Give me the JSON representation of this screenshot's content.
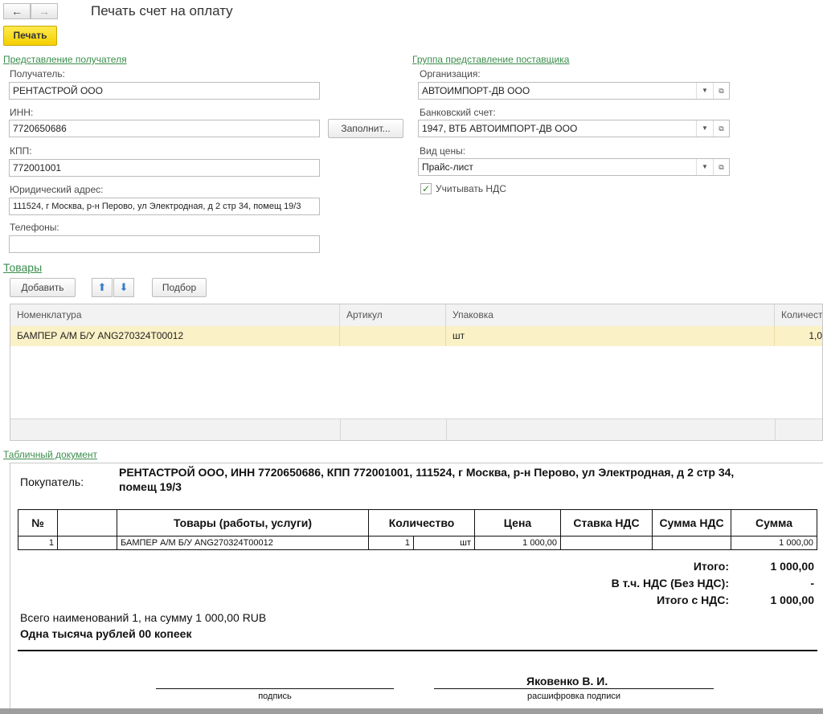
{
  "window": {
    "title": "Печать счет на оплату",
    "print_label": "Печать",
    "back_glyph": "←",
    "forward_glyph": "→"
  },
  "recipient": {
    "group_title": "Представление получателя",
    "recipient_label": "Получатель:",
    "recipient_value": "РЕНТАСТРОЙ ООО",
    "inn_label": "ИНН:",
    "inn_value": "7720650686",
    "fill_button": "Заполнит...",
    "kpp_label": "КПП:",
    "kpp_value": "772001001",
    "address_label": "Юридический адрес:",
    "address_value": "111524, г Москва, р-н Перово, ул Электродная, д 2 стр 34, помещ 19/3",
    "phones_label": "Телефоны:",
    "phones_value": ""
  },
  "supplier": {
    "group_title": "Группа представление поставщика",
    "org_label": "Организация:",
    "org_value": "АВТОИМПОРТ-ДВ ООО",
    "bank_label": "Банковский счет:",
    "bank_value": "1947, ВТБ АВТОИМПОРТ-ДВ ООО",
    "price_label": "Вид цены:",
    "price_value": "Прайс-лист",
    "vat_checkbox_label": "Учитывать НДС",
    "vat_checked": true
  },
  "goods": {
    "title": "Товары",
    "add_button": "Добавить",
    "up_glyph": "⬆",
    "down_glyph": "⬇",
    "selection_button": "Подбор",
    "columns": [
      "Номенклатура",
      "Артикул",
      "Упаковка",
      "Количест"
    ],
    "rows": [
      {
        "name": "БАМПЕР А/М Б/У ANG270324T00012",
        "article": "",
        "package": "шт",
        "qty": "1,0"
      }
    ]
  },
  "document": {
    "section_title": "Табличный документ",
    "buyer_label": "Покупатель:",
    "buyer_line1": "РЕНТАСТРОЙ ООО, ИНН 7720650686, КПП 772001001, 111524, г Москва, р-н Перово, ул Электродная, д 2 стр 34,",
    "buyer_line2": "помещ 19/3",
    "table_headers": [
      "№",
      "Товары (работы, услуги)",
      "Количество",
      "Цена",
      "Ставка НДС",
      "Сумма НДС",
      "Сумма"
    ],
    "table_rows": [
      {
        "num": "1",
        "name": "БАМПЕР А/М Б/У ANG270324T00012",
        "qty": "1",
        "unit": "шт",
        "price": "1 000,00",
        "vat_rate": "",
        "vat_sum": "",
        "sum": "1 000,00"
      }
    ],
    "total_label": "Итого:",
    "total_value": "1 000,00",
    "vat_label": "В т.ч. НДС (Без НДС):",
    "vat_value": "-",
    "total_vat_label": "Итого с НДС:",
    "total_vat_value": "1 000,00",
    "summary_line": "Всего наименований 1, на сумму 1 000,00 RUB",
    "amount_words": "Одна тысяча рублей 00 копеек",
    "signer_name": "Яковенко В. И.",
    "signature_caption": "подпись",
    "decode_caption": "расшифровка подписи"
  },
  "colors": {
    "accent_green": "#3b8d4c",
    "print_button_yellow": "#f4cf00",
    "selected_row": "#fbf1c6"
  }
}
